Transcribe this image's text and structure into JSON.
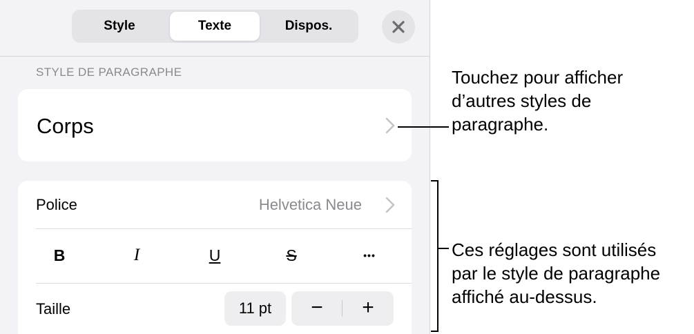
{
  "tabs": [
    {
      "label": "Style",
      "active": false
    },
    {
      "label": "Texte",
      "active": true
    },
    {
      "label": "Dispos.",
      "active": false
    }
  ],
  "section": {
    "paragraph_style_label": "STYLE DE PARAGRAPHE"
  },
  "paragraph_style": {
    "name": "Corps"
  },
  "font": {
    "label": "Police",
    "value": "Helvetica Neue"
  },
  "format_buttons": {
    "bold": "B",
    "italic": "I",
    "underline": "U",
    "strikethrough": "S",
    "more": "•••"
  },
  "size": {
    "label": "Taille",
    "value": "11 pt",
    "decrease": "−",
    "increase": "+"
  },
  "callouts": {
    "top": [
      "Touchez pour afficher",
      "d’autres styles de",
      "paragraphe."
    ],
    "bottom": [
      "Ces réglages sont utilisés",
      "par le style de paragraphe",
      "affiché au-dessus."
    ]
  },
  "icons": {
    "close": "close-icon",
    "chevron": "chevron-right-icon"
  }
}
